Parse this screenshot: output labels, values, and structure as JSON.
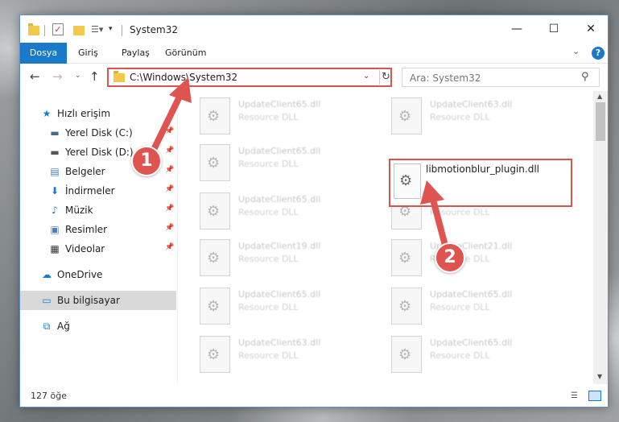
{
  "window": {
    "title": "System32",
    "quick_access_check": "✓",
    "controls": {
      "minimize": "—",
      "maximize": "☐",
      "close": "✕"
    }
  },
  "ribbon": {
    "tabs": [
      "Dosya",
      "Giriş",
      "Paylaş",
      "Görünüm"
    ],
    "collapse_glyph": "⌄",
    "help_glyph": "?"
  },
  "navigation": {
    "back_glyph": "←",
    "forward_glyph": "→",
    "recent_glyph": "⌄",
    "up_glyph": "↑",
    "address": "C:\\Windows\\System32",
    "address_dropdown_glyph": "⌄",
    "refresh_glyph": "↻",
    "search_placeholder": "Ara: System32",
    "search_glyph": "⚲"
  },
  "sidebar": {
    "items": [
      {
        "label": "Hızlı erişim",
        "icon": "star-icon",
        "glyph": "★",
        "color": "#1979ca",
        "pinned": false
      },
      {
        "label": "Yerel Disk (C:)",
        "icon": "drive-icon",
        "glyph": "▬",
        "color": "#4a6a8a",
        "pinned": true
      },
      {
        "label": "Yerel Disk (D:)",
        "icon": "drive-icon",
        "glyph": "▬",
        "color": "#555555",
        "pinned": true
      },
      {
        "label": "Belgeler",
        "icon": "documents-icon",
        "glyph": "▤",
        "color": "#4a7cc8",
        "pinned": true
      },
      {
        "label": "İndirmeler",
        "icon": "download-icon",
        "glyph": "⬇",
        "color": "#1979ca",
        "pinned": true
      },
      {
        "label": "Müzik",
        "icon": "music-icon",
        "glyph": "♪",
        "color": "#1979ca",
        "pinned": true
      },
      {
        "label": "Resimler",
        "icon": "pictures-icon",
        "glyph": "▣",
        "color": "#4a7cc8",
        "pinned": true
      },
      {
        "label": "Videolar",
        "icon": "videos-icon",
        "glyph": "▦",
        "color": "#333333",
        "pinned": true
      },
      {
        "label": "OneDrive",
        "icon": "cloud-icon",
        "glyph": "☁",
        "color": "#1979ca",
        "pinned": false
      },
      {
        "label": "Bu bilgisayar",
        "icon": "computer-icon",
        "glyph": "▭",
        "color": "#1979ca",
        "pinned": false,
        "selected": true
      },
      {
        "label": "Ağ",
        "icon": "network-icon",
        "glyph": "⧉",
        "color": "#1979ca",
        "pinned": false
      }
    ],
    "pin_glyph": "📌"
  },
  "files": {
    "left_column": [
      {
        "name": "UpdateClient65.dll",
        "type": "Resource DLL"
      },
      {
        "name": "UpdateClient65.dll",
        "type": "Resource DLL"
      },
      {
        "name": "UpdateClient65.dll",
        "type": "Resource DLL"
      },
      {
        "name": "UpdateClient19.dll",
        "type": "Resource DLL"
      },
      {
        "name": "UpdateClient65.dll",
        "type": "Resource DLL"
      },
      {
        "name": "UpdateClient63.dll",
        "type": "Resource DLL"
      }
    ],
    "right_column": [
      {
        "name": "UpdateClient63.dll",
        "type": "Resource DLL"
      },
      {
        "name": "UpdateClient21.dll",
        "type": "Resource DLL"
      },
      {
        "name": "UpdateClient21.dll",
        "type": "Resource DLL"
      },
      {
        "name": "UpdateClient65.dll",
        "type": "Resource DLL"
      },
      {
        "name": "UpdateClient65.dll",
        "type": "Resource DLL"
      }
    ],
    "highlighted": {
      "name": "libmotionblur_plugin.dll"
    }
  },
  "scrollbar": {
    "up_glyph": "▲",
    "down_glyph": "▼"
  },
  "status": {
    "item_count": "127 öğe",
    "details_view_glyph": "☰"
  },
  "annotations": [
    {
      "number": "1",
      "color": "#e0544f"
    },
    {
      "number": "2",
      "color": "#e0544f"
    }
  ]
}
